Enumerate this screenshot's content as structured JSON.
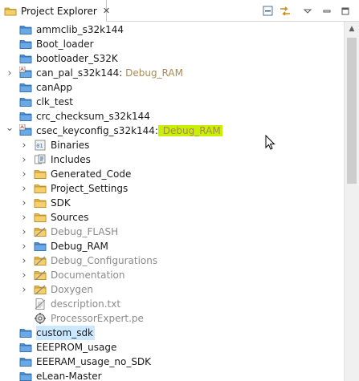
{
  "tab": {
    "title": "Project Explorer",
    "close_glyph": "✕",
    "icon": "project-explorer-icon"
  },
  "toolbar": [
    {
      "name": "collapse-all-button",
      "icon": "collapse-all-icon"
    },
    {
      "name": "link-with-editor-button",
      "icon": "link-with-editor-icon"
    },
    {
      "name": "view-menu-button",
      "icon": "view-menu-icon"
    },
    {
      "name": "minimize-button",
      "icon": "minimize-icon"
    },
    {
      "name": "maximize-button",
      "icon": "maximize-icon"
    }
  ],
  "tree": [
    {
      "label": "ammclib_s32k144",
      "level": 0,
      "twisty": "",
      "icon": "folder"
    },
    {
      "label": "Boot_loader",
      "level": 0,
      "twisty": "",
      "icon": "folder"
    },
    {
      "label": "bootloader_S32K",
      "level": 0,
      "twisty": "",
      "icon": "folder"
    },
    {
      "label": "can_pal_s32k144:",
      "decoration": " Debug_RAM",
      "level": 0,
      "twisty": "collapsed",
      "icon": "project"
    },
    {
      "label": "canApp",
      "level": 0,
      "twisty": "",
      "icon": "folder"
    },
    {
      "label": "clk_test",
      "level": 0,
      "twisty": "",
      "icon": "folder"
    },
    {
      "label": "crc_checksum_s32k144",
      "level": 0,
      "twisty": "",
      "icon": "folder"
    },
    {
      "label": "csec_keyconfig_s32k144:",
      "decoration": " Debug_RAM",
      "highlight": true,
      "level": 0,
      "twisty": "expanded",
      "icon": "project"
    },
    {
      "label": "Binaries",
      "level": 1,
      "twisty": "collapsed",
      "icon": "binaries"
    },
    {
      "label": "Includes",
      "level": 1,
      "twisty": "collapsed",
      "icon": "includes"
    },
    {
      "label": "Generated_Code",
      "level": 1,
      "twisty": "collapsed",
      "icon": "src-folder"
    },
    {
      "label": "Project_Settings",
      "level": 1,
      "twisty": "collapsed",
      "icon": "src-folder"
    },
    {
      "label": "SDK",
      "level": 1,
      "twisty": "collapsed",
      "icon": "src-folder"
    },
    {
      "label": "Sources",
      "level": 1,
      "twisty": "collapsed",
      "icon": "src-folder"
    },
    {
      "label": "Debug_FLASH",
      "level": 1,
      "twisty": "collapsed",
      "icon": "excluded-folder",
      "dim": true
    },
    {
      "label": "Debug_RAM",
      "level": 1,
      "twisty": "collapsed",
      "icon": "folder"
    },
    {
      "label": "Debug_Configurations",
      "level": 1,
      "twisty": "collapsed",
      "icon": "excluded-folder",
      "dim": true
    },
    {
      "label": "Documentation",
      "level": 1,
      "twisty": "collapsed",
      "icon": "excluded-folder",
      "dim": true
    },
    {
      "label": "Doxygen",
      "level": 1,
      "twisty": "collapsed",
      "icon": "excluded-folder",
      "dim": true
    },
    {
      "label": "description.txt",
      "level": 1,
      "twisty": "",
      "icon": "text-file",
      "dim": true
    },
    {
      "label": "ProcessorExpert.pe",
      "level": 1,
      "twisty": "",
      "icon": "pe-file",
      "dim": true
    },
    {
      "label": "custom_sdk",
      "level": 0,
      "twisty": "",
      "icon": "folder",
      "selected": true
    },
    {
      "label": "EEEPROM_usage",
      "level": 0,
      "twisty": "",
      "icon": "folder"
    },
    {
      "label": "EEERAM_usage_no_SDK",
      "level": 0,
      "twisty": "",
      "icon": "folder"
    },
    {
      "label": "eLean-Master",
      "level": 0,
      "twisty": "",
      "icon": "folder"
    }
  ],
  "colors": {
    "folder": "#4a8fd6",
    "selection": "#cce8ff",
    "highlight": "#c8f000",
    "decoration": "#a88a55"
  }
}
